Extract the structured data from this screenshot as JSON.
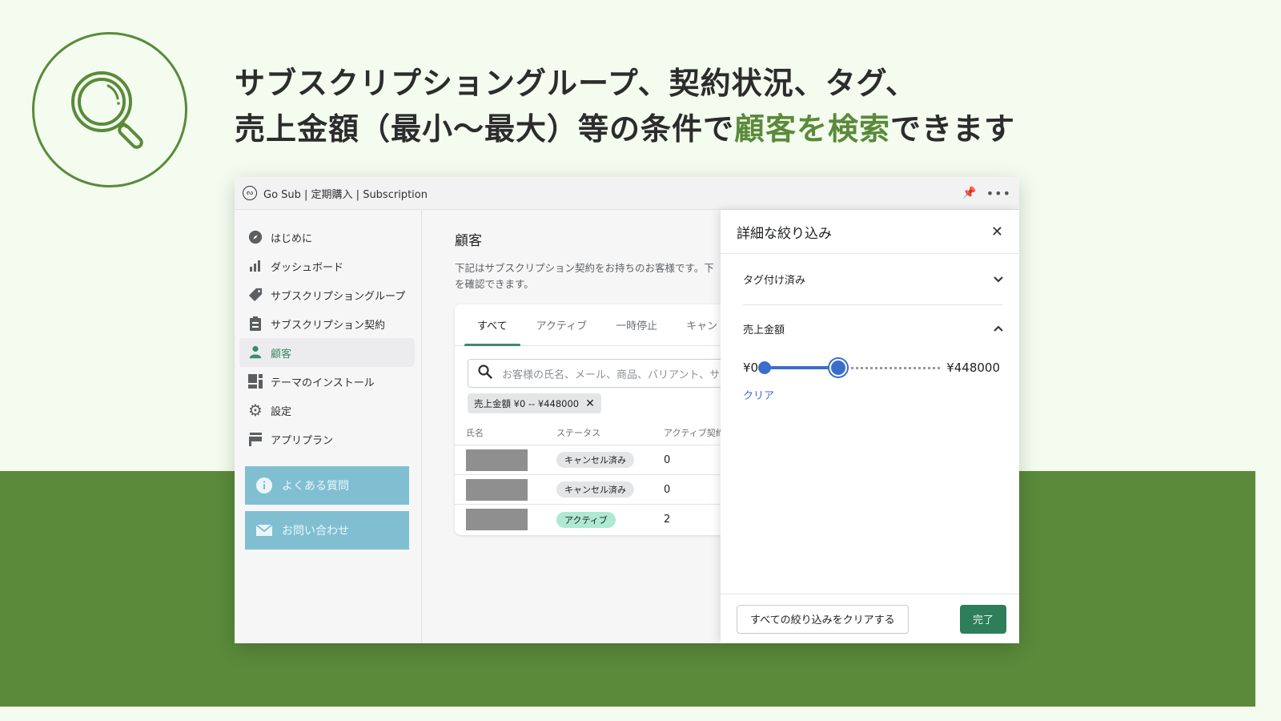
{
  "promo": {
    "headline_line1": "サブスクリプショングループ、契約状況、タグ、",
    "headline_line2_prefix": "売上金額（最小〜最大）等の条件で",
    "headline_line2_accent": "顧客を検索",
    "headline_line2_suffix": "できます",
    "accent_color": "#5a8a3a",
    "icon": "magnifier-icon"
  },
  "window": {
    "title": "Go Sub | 定期購入 | Subscription",
    "pin_icon": "pin-icon",
    "more_icon": "more-icon"
  },
  "sidebar": {
    "items": [
      {
        "label": "はじめに",
        "icon": "compass-icon",
        "active": false
      },
      {
        "label": "ダッシュボード",
        "icon": "bar-chart-icon",
        "active": false
      },
      {
        "label": "サブスクリプショングループ",
        "icon": "tag-icon",
        "active": false
      },
      {
        "label": "サブスクリプション契約",
        "icon": "clipboard-icon",
        "active": false
      },
      {
        "label": "顧客",
        "icon": "person-icon",
        "active": true
      },
      {
        "label": "テーマのインストール",
        "icon": "layout-icon",
        "active": false
      },
      {
        "label": "設定",
        "icon": "gear-icon",
        "active": false
      },
      {
        "label": "アプリプラン",
        "icon": "plan-icon",
        "active": false
      }
    ],
    "buttons": [
      {
        "label": "よくある質問",
        "icon": "info-icon"
      },
      {
        "label": "お問い合わせ",
        "icon": "mail-icon"
      }
    ]
  },
  "main": {
    "title": "顧客",
    "description_line1": "下記はサブスクリプション契約をお持ちのお客様です。下",
    "description_line2": "を確認できます。",
    "tabs": [
      {
        "label": "すべて",
        "active": true
      },
      {
        "label": "アクティブ",
        "active": false
      },
      {
        "label": "一時停止",
        "active": false
      },
      {
        "label": "キャン",
        "active": false
      }
    ],
    "search": {
      "placeholder": "お客様の氏名、メール、商品、バリアント、サ"
    },
    "filter_chip": {
      "label": "売上金額 ¥0 -- ¥448000"
    },
    "table": {
      "columns": [
        "氏名",
        "ステータス",
        "アクティブ契約"
      ],
      "rows": [
        {
          "name": "",
          "status": "キャンセル済み",
          "status_type": "cancelled",
          "active_count": "0"
        },
        {
          "name": "",
          "status": "キャンセル済み",
          "status_type": "cancelled",
          "active_count": "0"
        },
        {
          "name": "",
          "status": "アクティブ",
          "status_type": "active",
          "active_count": "2"
        }
      ]
    }
  },
  "filter_panel": {
    "title": "詳細な絞り込み",
    "sections": [
      {
        "label": "タグ付け済み",
        "expanded": false
      },
      {
        "label": "売上金額",
        "expanded": true
      }
    ],
    "slider": {
      "min_label": "¥0",
      "max_label": "¥448000",
      "low_fraction": 0.0,
      "high_fraction": 0.42
    },
    "clear_label": "クリア",
    "clear_all_label": "すべての絞り込みをクリアする",
    "done_label": "完了"
  }
}
